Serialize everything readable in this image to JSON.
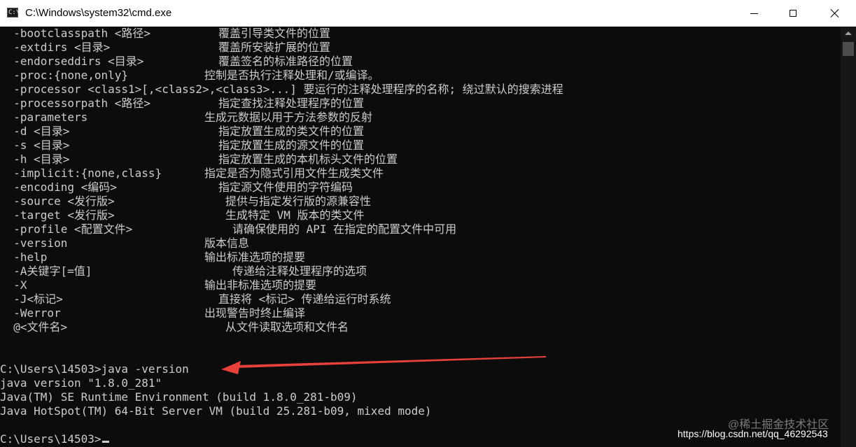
{
  "window": {
    "title": "C:\\Windows\\system32\\cmd.exe",
    "icon_glyph": "C:\\",
    "icon_name": "cmd-icon"
  },
  "controls": {
    "minimize": "minimize-icon",
    "maximize": "maximize-icon",
    "close": "close-icon"
  },
  "options": [
    {
      "flag": "  -bootclasspath <路径>",
      "desc": "覆盖引导类文件的位置"
    },
    {
      "flag": "  -extdirs <目录>",
      "desc": "覆盖所安装扩展的位置"
    },
    {
      "flag": "  -endorseddirs <目录>",
      "desc": "覆盖签名的标准路径的位置"
    },
    {
      "flag": "  -proc:{none,only}",
      "desc": "控制是否执行注释处理和/或编译。"
    },
    {
      "flag": "  -processor <class1>[,<class2>,<class3>...] 要运行的注释处理程序的名称; 绕过默认的搜索进程",
      "desc": ""
    },
    {
      "flag": "  -processorpath <路径>",
      "desc": "指定查找注释处理程序的位置"
    },
    {
      "flag": "  -parameters",
      "desc": "生成元数据以用于方法参数的反射"
    },
    {
      "flag": "  -d <目录>",
      "desc": "指定放置生成的类文件的位置"
    },
    {
      "flag": "  -s <目录>",
      "desc": "指定放置生成的源文件的位置"
    },
    {
      "flag": "  -h <目录>",
      "desc": "指定放置生成的本机标头文件的位置"
    },
    {
      "flag": "  -implicit:{none,class}",
      "desc": "指定是否为隐式引用文件生成类文件"
    },
    {
      "flag": "  -encoding <编码>",
      "desc": "指定源文件使用的字符编码"
    },
    {
      "flag": "  -source <发行版>",
      "desc": "提供与指定发行版的源兼容性"
    },
    {
      "flag": "  -target <发行版>",
      "desc": "生成特定 VM 版本的类文件"
    },
    {
      "flag": "  -profile <配置文件>",
      "desc": "请确保使用的 API 在指定的配置文件中可用"
    },
    {
      "flag": "  -version",
      "desc": "版本信息"
    },
    {
      "flag": "  -help",
      "desc": "输出标准选项的提要"
    },
    {
      "flag": "  -A关键字[=值]",
      "desc": "传递给注释处理程序的选项"
    },
    {
      "flag": "  -X",
      "desc": "输出非标准选项的提要"
    },
    {
      "flag": "  -J<标记>",
      "desc": "直接将 <标记> 传递给运行时系统"
    },
    {
      "flag": "  -Werror",
      "desc": "出现警告时终止编译"
    },
    {
      "flag": "  @<文件名>",
      "desc": "从文件读取选项和文件名"
    }
  ],
  "session": {
    "command_line": "C:\\Users\\14503>java -version",
    "output": [
      "java version \"1.8.0_281\"",
      "Java(TM) SE Runtime Environment (build 1.8.0_281-b09)",
      "Java HotSpot(TM) 64-Bit Server VM (build 25.281-b09, mixed mode)"
    ],
    "prompt": "C:\\Users\\14503>"
  },
  "annotation": {
    "arrow_color": "#e8403a"
  },
  "watermark": {
    "csdn": "https://blog.csdn.net/qq_46292543",
    "juejin": "@稀土掘金技术社区"
  }
}
